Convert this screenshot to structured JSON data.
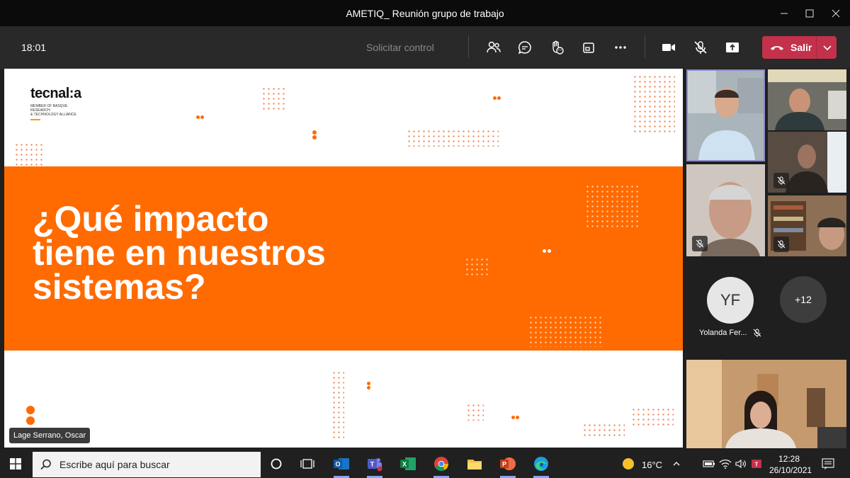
{
  "window": {
    "title": "AMETIQ_ Reunión grupo de trabajo"
  },
  "toolbar": {
    "time": "18:01",
    "request_control": "Solicitar control",
    "leave_label": "Salir"
  },
  "slide": {
    "logo_text": "tecnal:a",
    "logo_subtitle": "MEMBER OF BASQUE RESEARCH\n& TECHNOLOGY ALLIANCE",
    "headline": "¿Qué impacto\ntiene en nuestros\nsistemas?"
  },
  "presenter": {
    "name": "Lage Serrano, Oscar"
  },
  "participants": {
    "yf_initials": "YF",
    "yf_name": "Yolanda Fer...",
    "overflow": "+12"
  },
  "taskbar": {
    "search_placeholder": "Escribe aquí para buscar",
    "weather": "16°C",
    "clock_time": "12:28",
    "clock_date": "26/10/2021"
  },
  "colors": {
    "slide_orange": "#ff6b00",
    "leave_red": "#c4314b",
    "teams_purple": "#8b8cc7"
  }
}
